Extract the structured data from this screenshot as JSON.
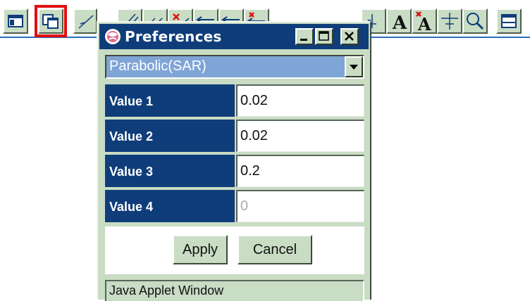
{
  "dialog": {
    "title": "Preferences",
    "indicator_select": {
      "selected": "Parabolic(SAR)"
    },
    "rows": [
      {
        "label": "Value 1",
        "value": "0.02",
        "enabled": true
      },
      {
        "label": "Value 2",
        "value": "0.02",
        "enabled": true
      },
      {
        "label": "Value 3",
        "value": "0.2",
        "enabled": true
      },
      {
        "label": "Value 4",
        "value": "0",
        "enabled": false
      }
    ],
    "apply_label": "Apply",
    "cancel_label": "Cancel",
    "status_text": "Java Applet Window"
  },
  "toolbar": {
    "selected_tool": "preferences-tool",
    "icons": [
      "window-icon",
      "preferences-icon",
      "trend-line-icon",
      "channel-line-icon",
      "parallel-line-icon",
      "delete-line-icon",
      "horizontal-line-icon",
      "arrow-line-icon",
      "delete-horizontal-icon",
      "crosshair-icon",
      "text-icon",
      "delete-text-icon",
      "cross-cursor-icon",
      "zoom-icon",
      "panel-icon"
    ]
  },
  "colors": {
    "panel": "#c9dcc4",
    "title_bar": "#0f3d7a",
    "label_bg": "#0f3d7a",
    "dropdown_bg": "#7fa4d6",
    "selected_outline": "#e01010"
  }
}
